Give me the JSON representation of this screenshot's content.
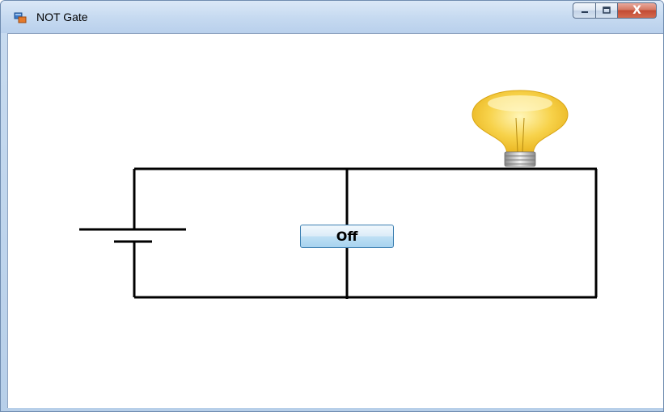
{
  "window": {
    "title": "NOT Gate",
    "app_icon": "winforms-app-icon",
    "caption_buttons": {
      "minimize_icon": "minimize-icon",
      "maximize_icon": "maximize-icon",
      "close_label": "X"
    }
  },
  "main": {
    "toggle_button_label": "Off",
    "bulb_state": "on",
    "bulb_color": "#f7d24a",
    "wire_color": "#000000"
  }
}
